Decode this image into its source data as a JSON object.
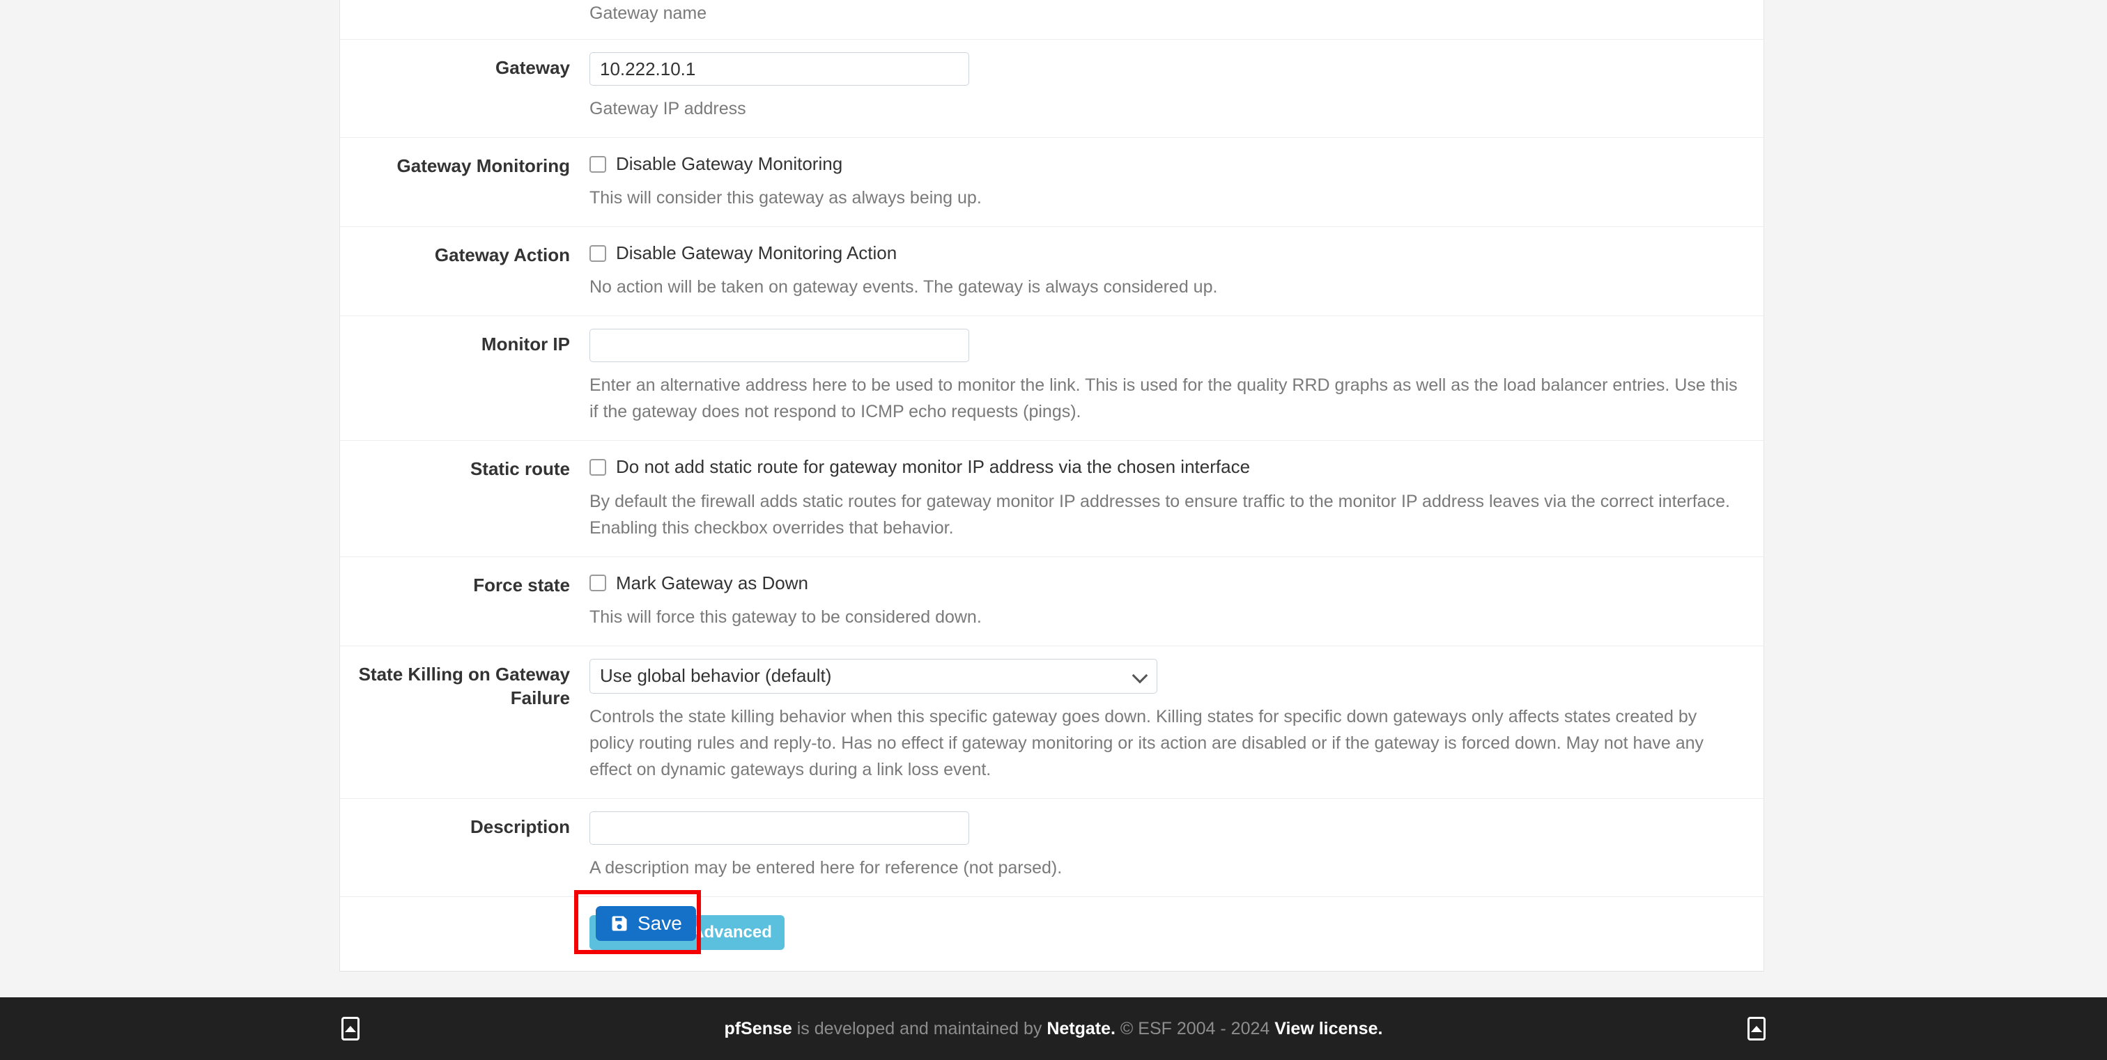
{
  "form": {
    "top_row": {
      "help": "Gateway name"
    },
    "rows": [
      {
        "label": "Gateway",
        "input_value": "10.222.10.1",
        "help": "Gateway IP address"
      },
      {
        "label": "Gateway Monitoring",
        "checkbox_label": "Disable Gateway Monitoring",
        "help": "This will consider this gateway as always being up."
      },
      {
        "label": "Gateway Action",
        "checkbox_label": "Disable Gateway Monitoring Action",
        "help": "No action will be taken on gateway events. The gateway is always considered up."
      },
      {
        "label": "Monitor IP",
        "input_value": "",
        "help": "Enter an alternative address here to be used to monitor the link. This is used for the quality RRD graphs as well as the load balancer entries. Use this if the gateway does not respond to ICMP echo requests (pings)."
      },
      {
        "label": "Static route",
        "checkbox_label": "Do not add static route for gateway monitor IP address via the chosen interface",
        "help": "By default the firewall adds static routes for gateway monitor IP addresses to ensure traffic to the monitor IP address leaves via the correct interface. Enabling this checkbox overrides that behavior."
      },
      {
        "label": "Force state",
        "checkbox_label": "Mark Gateway as Down",
        "help": "This will force this gateway to be considered down."
      },
      {
        "label": "State Killing on Gateway Failure",
        "select_value": "Use global behavior (default)",
        "help": "Controls the state killing behavior when this specific gateway goes down. Killing states for specific down gateways only affects states created by policy routing rules and reply-to. Has no effect if gateway monitoring or its action are disabled or if the gateway is forced down. May not have any effect on dynamic gateways during a link loss event."
      },
      {
        "label": "Description",
        "input_value": "",
        "help": "A description may be entered here for reference (not parsed)."
      }
    ],
    "advanced_button_label": "Display Advanced",
    "save_button_label": "Save"
  },
  "footer": {
    "product": "pfSense",
    "mid_text": " is developed and maintained by ",
    "company": "Netgate.",
    "copyright": " © ESF 2004 - 2024 ",
    "license_link": "View license."
  },
  "colors": {
    "accent_blue": "#1570c8",
    "info_blue": "#5bc0de",
    "highlight_red": "#f40000",
    "footer_bg": "#212121",
    "page_bg": "#f4f4f4"
  }
}
